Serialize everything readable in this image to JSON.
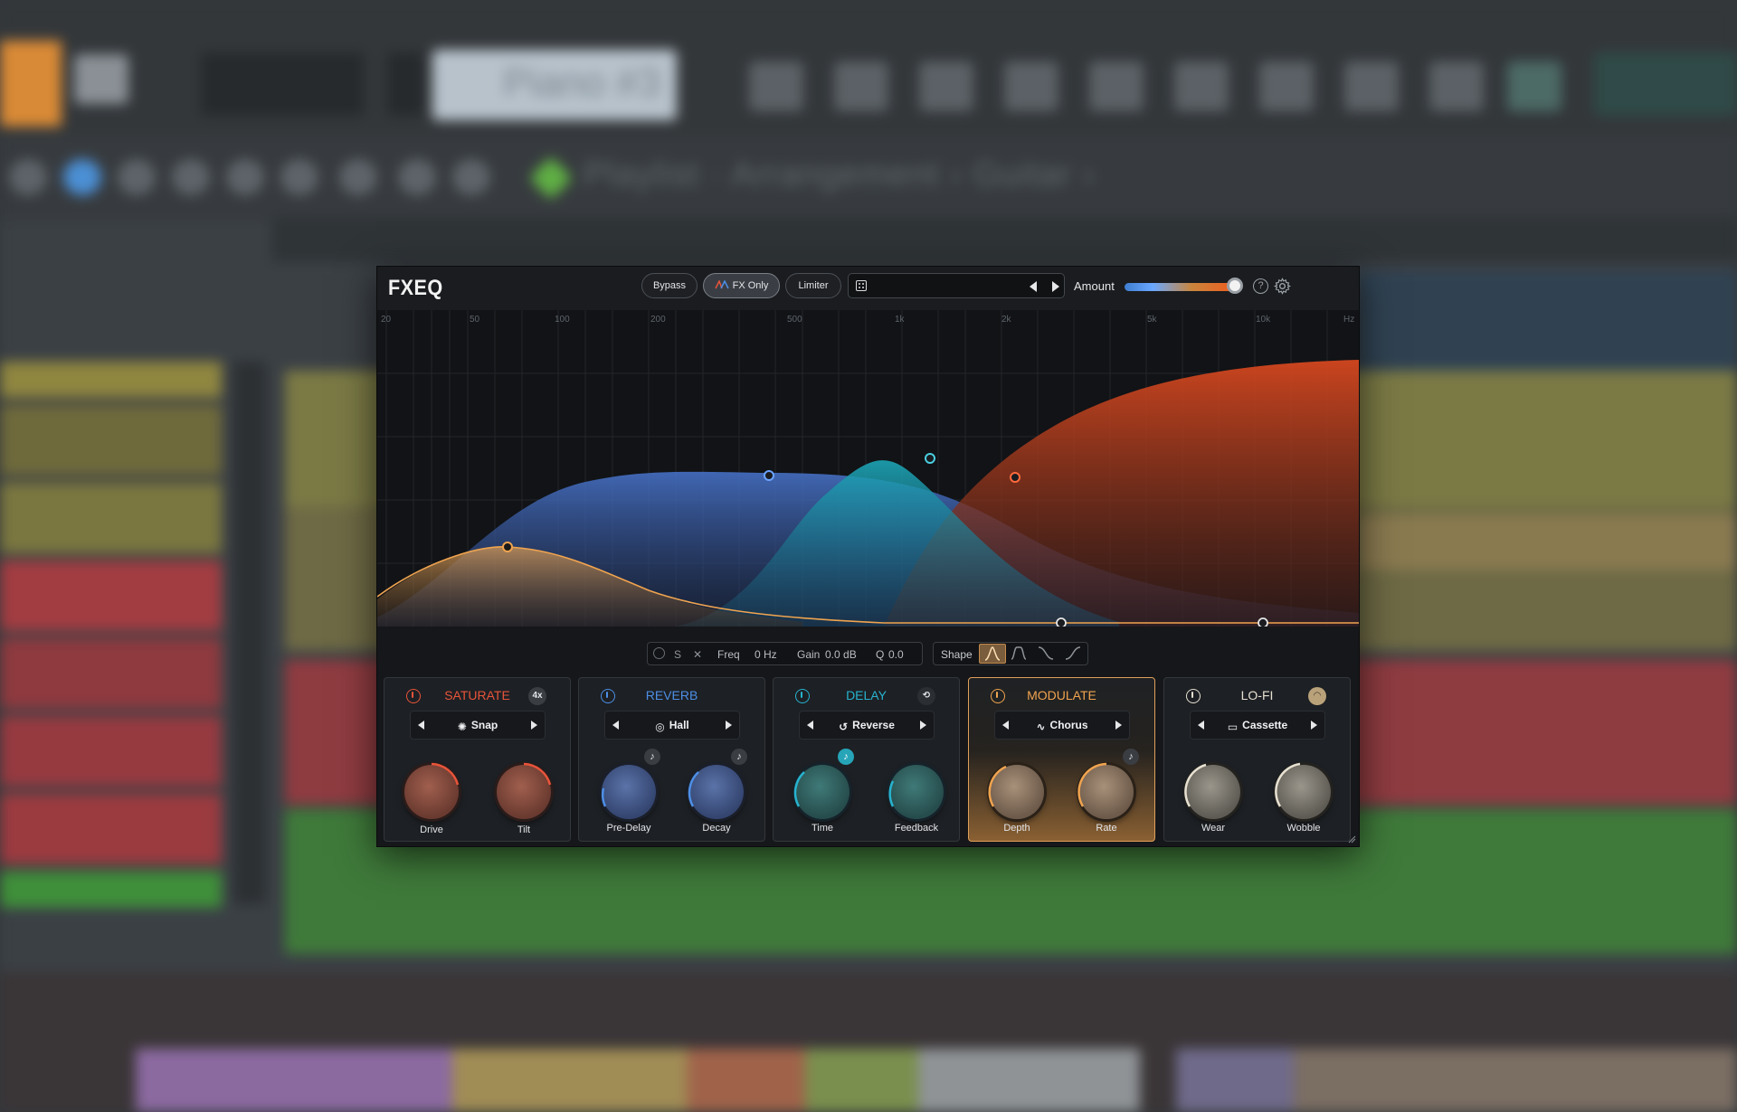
{
  "daw": {
    "pattern_name": "Piano #3",
    "breadcrumb": "Playlist · Arrangement › Guitar ›"
  },
  "plugin": {
    "logo": "FXEQ",
    "buttons": {
      "bypass": "Bypass",
      "fx_only": "FX Only",
      "limiter": "Limiter"
    },
    "preset_name": "",
    "amount_label": "Amount",
    "amount_value": 0.98,
    "help_glyph": "?",
    "freq_labels": [
      "20",
      "50",
      "100",
      "200",
      "500",
      "1k",
      "2k",
      "5k",
      "10k",
      "Hz"
    ],
    "band": {
      "solo": "S",
      "freq_label": "Freq",
      "freq_value": "0 Hz",
      "gain_label": "Gain",
      "gain_value": "0.0 dB",
      "q_label": "Q",
      "q_value": "0.0"
    },
    "shape_label": "Shape",
    "modules": [
      {
        "title": "SATURATE",
        "color": "#e8543a",
        "mode": "Snap",
        "corner": "4x",
        "knobs": [
          "Drive",
          "Tilt"
        ]
      },
      {
        "title": "REVERB",
        "color": "#4d8fe6",
        "mode": "Hall",
        "knobs": [
          "Pre-Delay",
          "Decay"
        ]
      },
      {
        "title": "DELAY",
        "color": "#27b3cf",
        "mode": "Reverse",
        "knobs": [
          "Time",
          "Feedback"
        ]
      },
      {
        "title": "MODULATE",
        "color": "#f0a44f",
        "mode": "Chorus",
        "knobs": [
          "Depth",
          "Rate"
        ]
      },
      {
        "title": "LO-FI",
        "color": "#e7e1d2",
        "mode": "Cassette",
        "knobs": [
          "Wear",
          "Wobble"
        ]
      }
    ],
    "colors": {
      "saturate": "#e2a25a",
      "reverb": "#4a72c2",
      "delay": "#1f9fb4",
      "lofi": "#e1542a"
    }
  }
}
